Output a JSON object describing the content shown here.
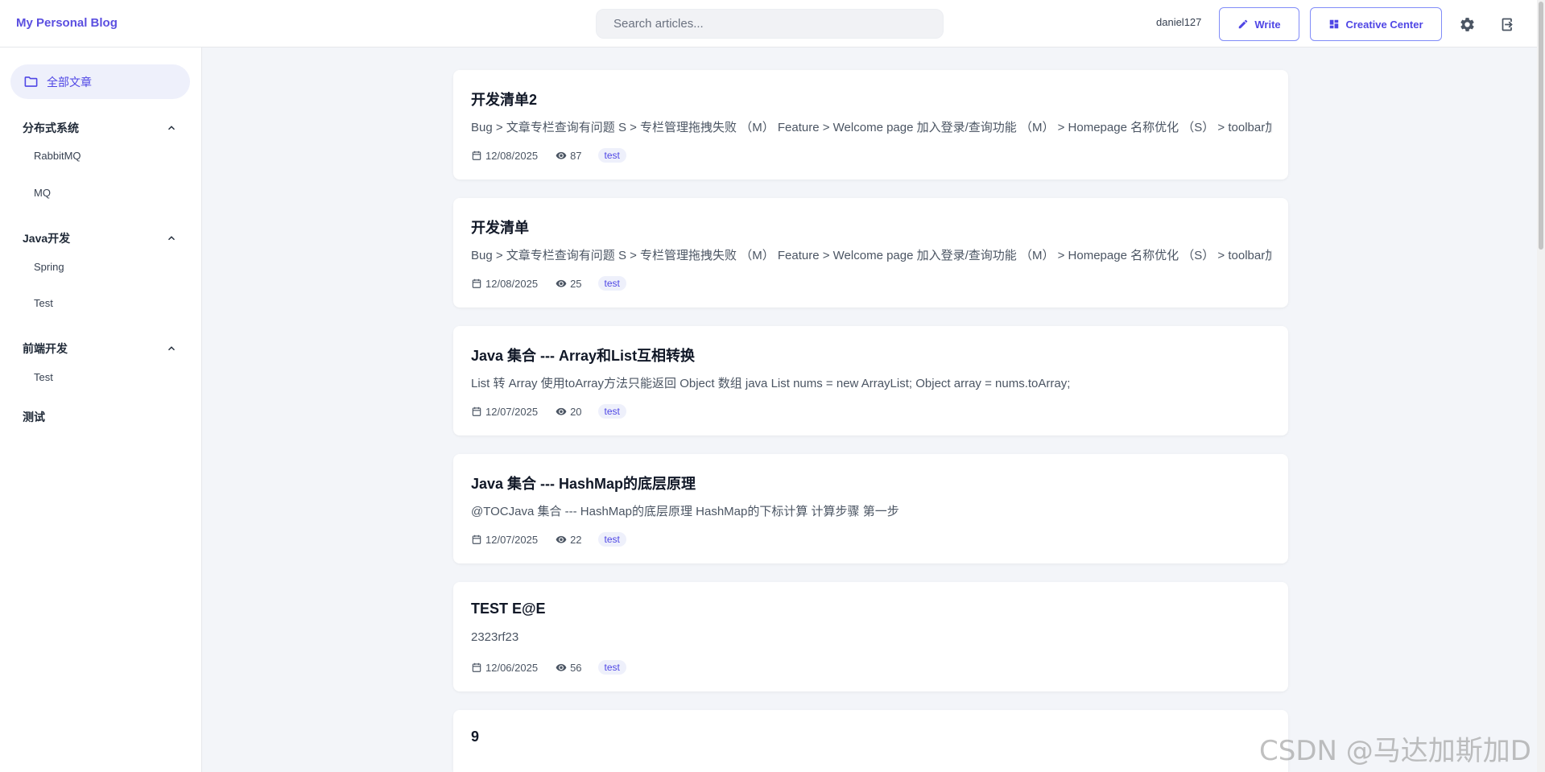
{
  "header": {
    "brand": "My Personal Blog",
    "search_placeholder": "Search articles...",
    "username": "daniel127",
    "write_label": "Write",
    "creative_label": "Creative Center"
  },
  "sidebar": {
    "all_label": "全部文章",
    "categories": [
      {
        "label": "分布式系统",
        "children": [
          "RabbitMQ",
          "MQ"
        ]
      },
      {
        "label": "Java开发",
        "children": [
          "Spring",
          "Test"
        ]
      },
      {
        "label": "前端开发",
        "children": [
          "Test"
        ]
      }
    ],
    "extra": "测试"
  },
  "articles": [
    {
      "title": "开发清单2",
      "summary": "Bug > 文章专栏查询有问题 S > 专栏管理拖拽失败 （M） Feature > Welcome page 加入登录/查询功能 （M） > Homepage 名称优化 （S） > toolbar加",
      "date": "12/08/2025",
      "views": "87",
      "tag": "test"
    },
    {
      "title": "开发清单",
      "summary": "Bug > 文章专栏查询有问题 S > 专栏管理拖拽失败 （M） Feature > Welcome page 加入登录/查询功能 （M） > Homepage 名称优化 （S） > toolbar加",
      "date": "12/08/2025",
      "views": "25",
      "tag": "test"
    },
    {
      "title": "Java 集合 --- Array和List互相转换",
      "summary": "List 转 Array 使用toArray方法只能返回 Object 数组 java List nums = new ArrayList; Object array = nums.toArray;",
      "date": "12/07/2025",
      "views": "20",
      "tag": "test"
    },
    {
      "title": "Java 集合 --- HashMap的底层原理",
      "summary": "@TOCJava 集合 --- HashMap的底层原理 HashMap的下标计算 计算步骤 第一步",
      "date": "12/07/2025",
      "views": "22",
      "tag": "test"
    },
    {
      "title": "TEST E@E",
      "summary": "2323rf23",
      "date": "12/06/2025",
      "views": "56",
      "tag": "test"
    },
    {
      "title": "9",
      "summary": "",
      "date": "",
      "views": "",
      "tag": ""
    }
  ],
  "watermark": "CSDN @马达加斯加D",
  "colors": {
    "accent": "#4f46e5",
    "brand": "#5b4fe0",
    "background": "#f3f5f9"
  }
}
